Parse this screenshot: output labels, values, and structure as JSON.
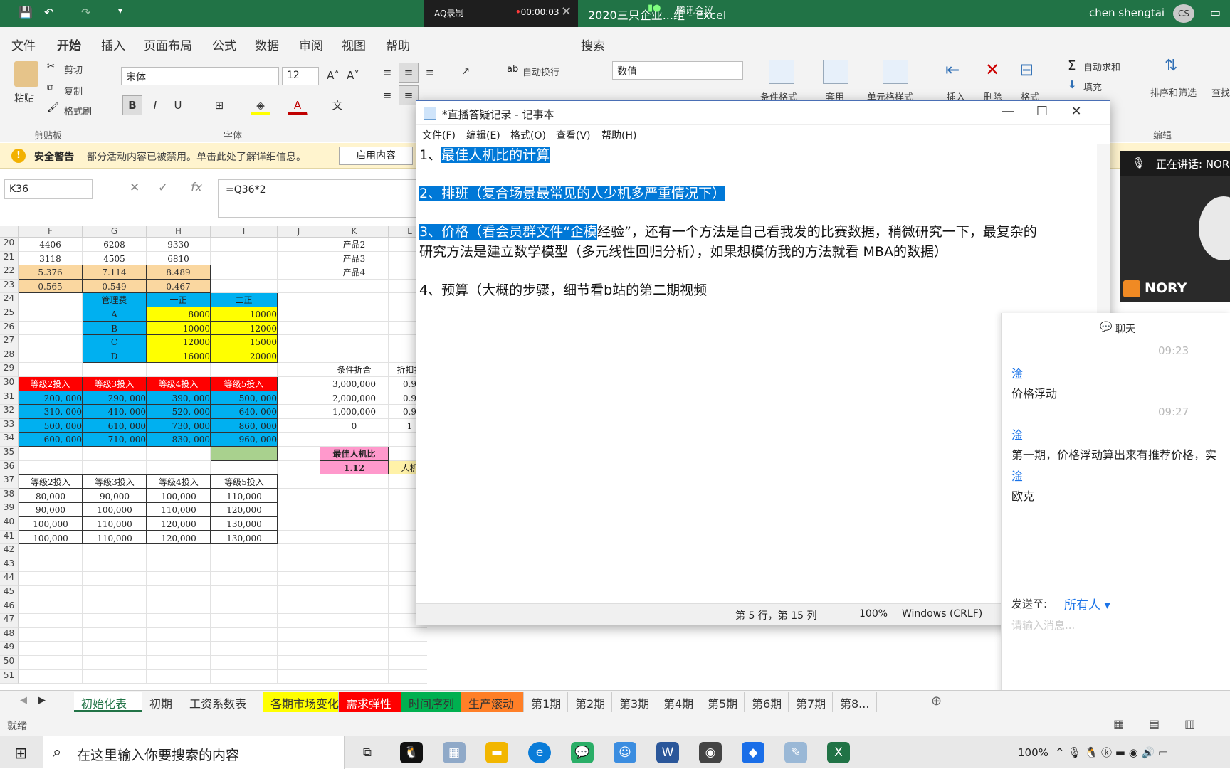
{
  "window": {
    "title": "2020三只企业...组 - Excel",
    "user": "chen shengtai",
    "user_initials": "CS"
  },
  "recorder": {
    "label": "AQ录制",
    "time": "00:00:03"
  },
  "meeting": {
    "label": "腾讯会议"
  },
  "menu": {
    "items": [
      "文件",
      "开始",
      "插入",
      "页面布局",
      "公式",
      "数据",
      "审阅",
      "视图",
      "帮助"
    ],
    "active": "开始",
    "search": "搜索"
  },
  "ribbon": {
    "paste": "粘贴",
    "cut": "剪切",
    "copy": "复制",
    "format_painter": "格式刷",
    "clipboard_group": "剪贴板",
    "font_name": "宋体",
    "font_size": "12",
    "font_group": "字体",
    "wrap": "自动换行",
    "number_format": "数值",
    "cond_format": "条件格式",
    "apply": "套用",
    "cell_style": "单元格样式",
    "insert": "插入",
    "delete": "删除",
    "format": "格式",
    "autosum": "自动求和",
    "fill": "填充",
    "sort": "排序和筛选",
    "find": "查找",
    "edit_group": "编辑"
  },
  "security": {
    "title": "安全警告",
    "message": "部分活动内容已被禁用。单击此处了解详细信息。",
    "button": "启用内容"
  },
  "formula_bar": {
    "name_box": "K36",
    "formula": "=Q36*2"
  },
  "sheet": {
    "columns": [
      "F",
      "G",
      "H",
      "I",
      "J",
      "K",
      "L"
    ],
    "row_numbers": [
      "20",
      "21",
      "22",
      "23",
      "24",
      "25",
      "26",
      "27",
      "28",
      "29",
      "30",
      "31",
      "32",
      "33",
      "34",
      "35",
      "36",
      "37",
      "38",
      "39",
      "40",
      "41",
      "42",
      "43",
      "44",
      "45",
      "46",
      "47",
      "48",
      "49",
      "50",
      "51"
    ],
    "rows": [
      [
        "4406",
        "6208",
        "9330",
        "",
        "",
        "产品2",
        ""
      ],
      [
        "3118",
        "4505",
        "6810",
        "",
        "",
        "产品3",
        ""
      ],
      [
        "5.376",
        "7.114",
        "8.489",
        "",
        "",
        "产品4",
        ""
      ],
      [
        "0.565",
        "0.549",
        "0.467",
        "",
        "",
        "",
        ""
      ],
      [
        "",
        "管理费",
        "一正",
        "二正",
        "",
        "",
        ""
      ],
      [
        "",
        "A",
        "8000",
        "10000",
        "",
        "",
        ""
      ],
      [
        "",
        "B",
        "10000",
        "12000",
        "",
        "",
        ""
      ],
      [
        "",
        "C",
        "12000",
        "15000",
        "",
        "",
        ""
      ],
      [
        "",
        "D",
        "16000",
        "20000",
        "",
        "",
        ""
      ],
      [
        "",
        "",
        "",
        "",
        "",
        "条件折合",
        "折扣扣"
      ],
      [
        "等级2投入",
        "等级3投入",
        "等级4投入",
        "等级5投入",
        "",
        "3,000,000",
        "0.9"
      ],
      [
        "200, 000",
        "290, 000",
        "390, 000",
        "500, 000",
        "",
        "2,000,000",
        "0.9"
      ],
      [
        "310, 000",
        "410, 000",
        "520, 000",
        "640, 000",
        "",
        "1,000,000",
        "0.9"
      ],
      [
        "500, 000",
        "610, 000",
        "730, 000",
        "860, 000",
        "",
        "0",
        "1"
      ],
      [
        "600, 000",
        "710, 000",
        "830, 000",
        "960, 000",
        "",
        "",
        ""
      ],
      [
        "",
        "",
        "",
        "",
        "",
        "最佳人机比",
        ""
      ],
      [
        "",
        "",
        "",
        "",
        "",
        "1.12",
        "人机"
      ],
      [
        "等级2投入",
        "等级3投入",
        "等级4投入",
        "等级5投入",
        "",
        "",
        ""
      ],
      [
        "80,000",
        "90,000",
        "100,000",
        "110,000",
        "",
        "",
        ""
      ],
      [
        "90,000",
        "100,000",
        "110,000",
        "120,000",
        "",
        "",
        ""
      ],
      [
        "100,000",
        "110,000",
        "120,000",
        "130,000",
        "",
        "",
        ""
      ],
      [
        "100,000",
        "110,000",
        "120,000",
        "130,000",
        "",
        "",
        ""
      ]
    ],
    "tabs": [
      "初始化表",
      "初期",
      "工资系数表",
      "各期市场变化",
      "需求弹性",
      "时间序列",
      "生产滚动",
      "第1期",
      "第2期",
      "第3期",
      "第4期",
      "第5期",
      "第6期",
      "第7期",
      "第8..."
    ],
    "status": "就绪"
  },
  "notepad": {
    "title": "*直播答疑记录 - 记事本",
    "menu": [
      "文件(F)",
      "编辑(E)",
      "格式(O)",
      "查看(V)",
      "帮助(H)"
    ],
    "line1_num": "1、",
    "line1_sel": "最佳人机比的计算",
    "line2_sel": "2、排班（复合场景最常见的人少机多严重情况下）",
    "line3_sel": "3、价格（看会员群文件“企模",
    "line3_rest": "经验”，还有一个方法是自己看我发的比赛数据，稍微研究一下，最复杂的",
    "line3b": "研究方法是建立数学模型（多元线性回归分析），如果想模仿我的方法就看 MBA的数据）",
    "line4": "4、预算（大概的步骤，细节看b站的第二期视频",
    "status_pos": "第 5 行，第 15 列",
    "status_zoom": "100%",
    "status_eol": "Windows (CRLF)"
  },
  "video": {
    "speaking": "正在讲话: NOR",
    "name": "NORY"
  },
  "chat": {
    "title": "聊天",
    "messages": [
      {
        "time": "09:23",
        "user": "淦",
        "text": "价格浮动"
      },
      {
        "time": "09:27",
        "user": "淦",
        "text": "第一期，价格浮动算出来有推荐价格，实"
      },
      {
        "time": "",
        "user": "淦",
        "text": "欧克"
      }
    ],
    "send_to_label": "发送至:",
    "send_to": "所有人",
    "placeholder": "请输入消息..."
  },
  "taskbar": {
    "search_placeholder": "在这里输入你要搜索的内容",
    "battery": "100%"
  },
  "colors": {
    "excel_green": "#217346",
    "header_blue": "#00b0f0",
    "yellow": "#ffff00",
    "orange": "#fad7a0",
    "red": "#ff0000",
    "pink": "#ff99cc",
    "selection": "#0078d7"
  }
}
